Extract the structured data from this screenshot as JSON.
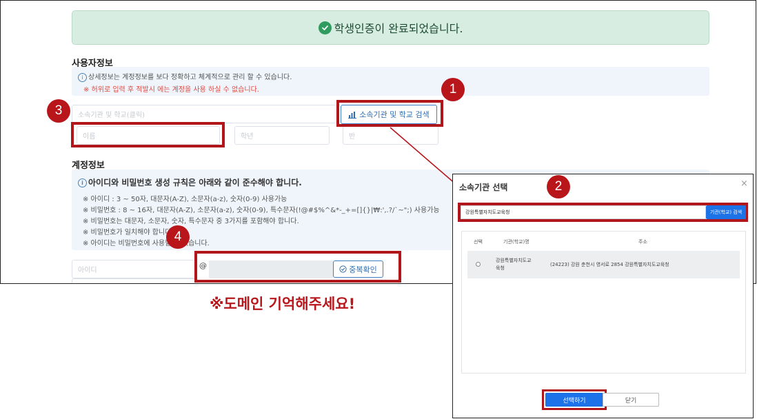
{
  "success_banner": {
    "text": "학생인증이 완료되었습니다."
  },
  "user_info": {
    "title": "사용자정보",
    "notice": "상세정보는 계정정보를 보다 정확하고 체계적으로 관리 할 수 있습니다.",
    "warning": "※ 허위로 입력 후 적발시 에는 계정을 사용 하실 수 없습니다.",
    "org_school_placeholder": "소속기관 및 학교(클릭)",
    "search_button": "소속기관 및 학교 검색",
    "name_placeholder": "이름",
    "grade_placeholder": "학년",
    "class_placeholder": "반"
  },
  "account_info": {
    "title": "계정정보",
    "rules_heading": "아이디와 비밀번호 생성 규칙은 아래와 같이 준수해야 합니다.",
    "rules": [
      "※ 아이디 : 3 ~ 50자, 대문자(A-Z), 소문자(a-z), 숫자(0-9) 사용가능",
      "※ 비밀번호 : 8 ~ 16자, 대문자(A-Z), 소문자(a-z), 숫자(0-9), 특수문자(!@#$%^&*-_+=[]{}|₩:',.?/`~\";) 사용가능",
      "※ 비밀번호는 대문자, 소문자, 숫자, 특수문자 중 3가지를 포함해야 합니다.",
      "※ 비밀번호가 일치해야 합니다.",
      "※ 아이디는 비밀번호에 사용할 수 없습니다."
    ],
    "id_placeholder": "아이디",
    "at_symbol": "@",
    "duplicate_check_button": "중복확인"
  },
  "annotation": {
    "remember_domain": "※도메인 기억해주세요!"
  },
  "badges": [
    "1",
    "2",
    "3",
    "4"
  ],
  "modal": {
    "title": "소속기관 선택",
    "close": "×",
    "search_value": "강원특별자치도교육청",
    "search_button": "기관(학교) 검색",
    "columns": [
      "선택",
      "기관(학교)명",
      "주소"
    ],
    "rows": [
      {
        "name": "강원특별자치도교육청",
        "address": "(24223) 강원 춘천시 영서로 2854 강원특별자치도교육청"
      }
    ],
    "select_button": "선택하기",
    "close_button": "닫기"
  },
  "colors": {
    "annotation_red": "#b8161b",
    "primary_blue": "#1e72e8",
    "success_bg": "#d8ede2"
  }
}
